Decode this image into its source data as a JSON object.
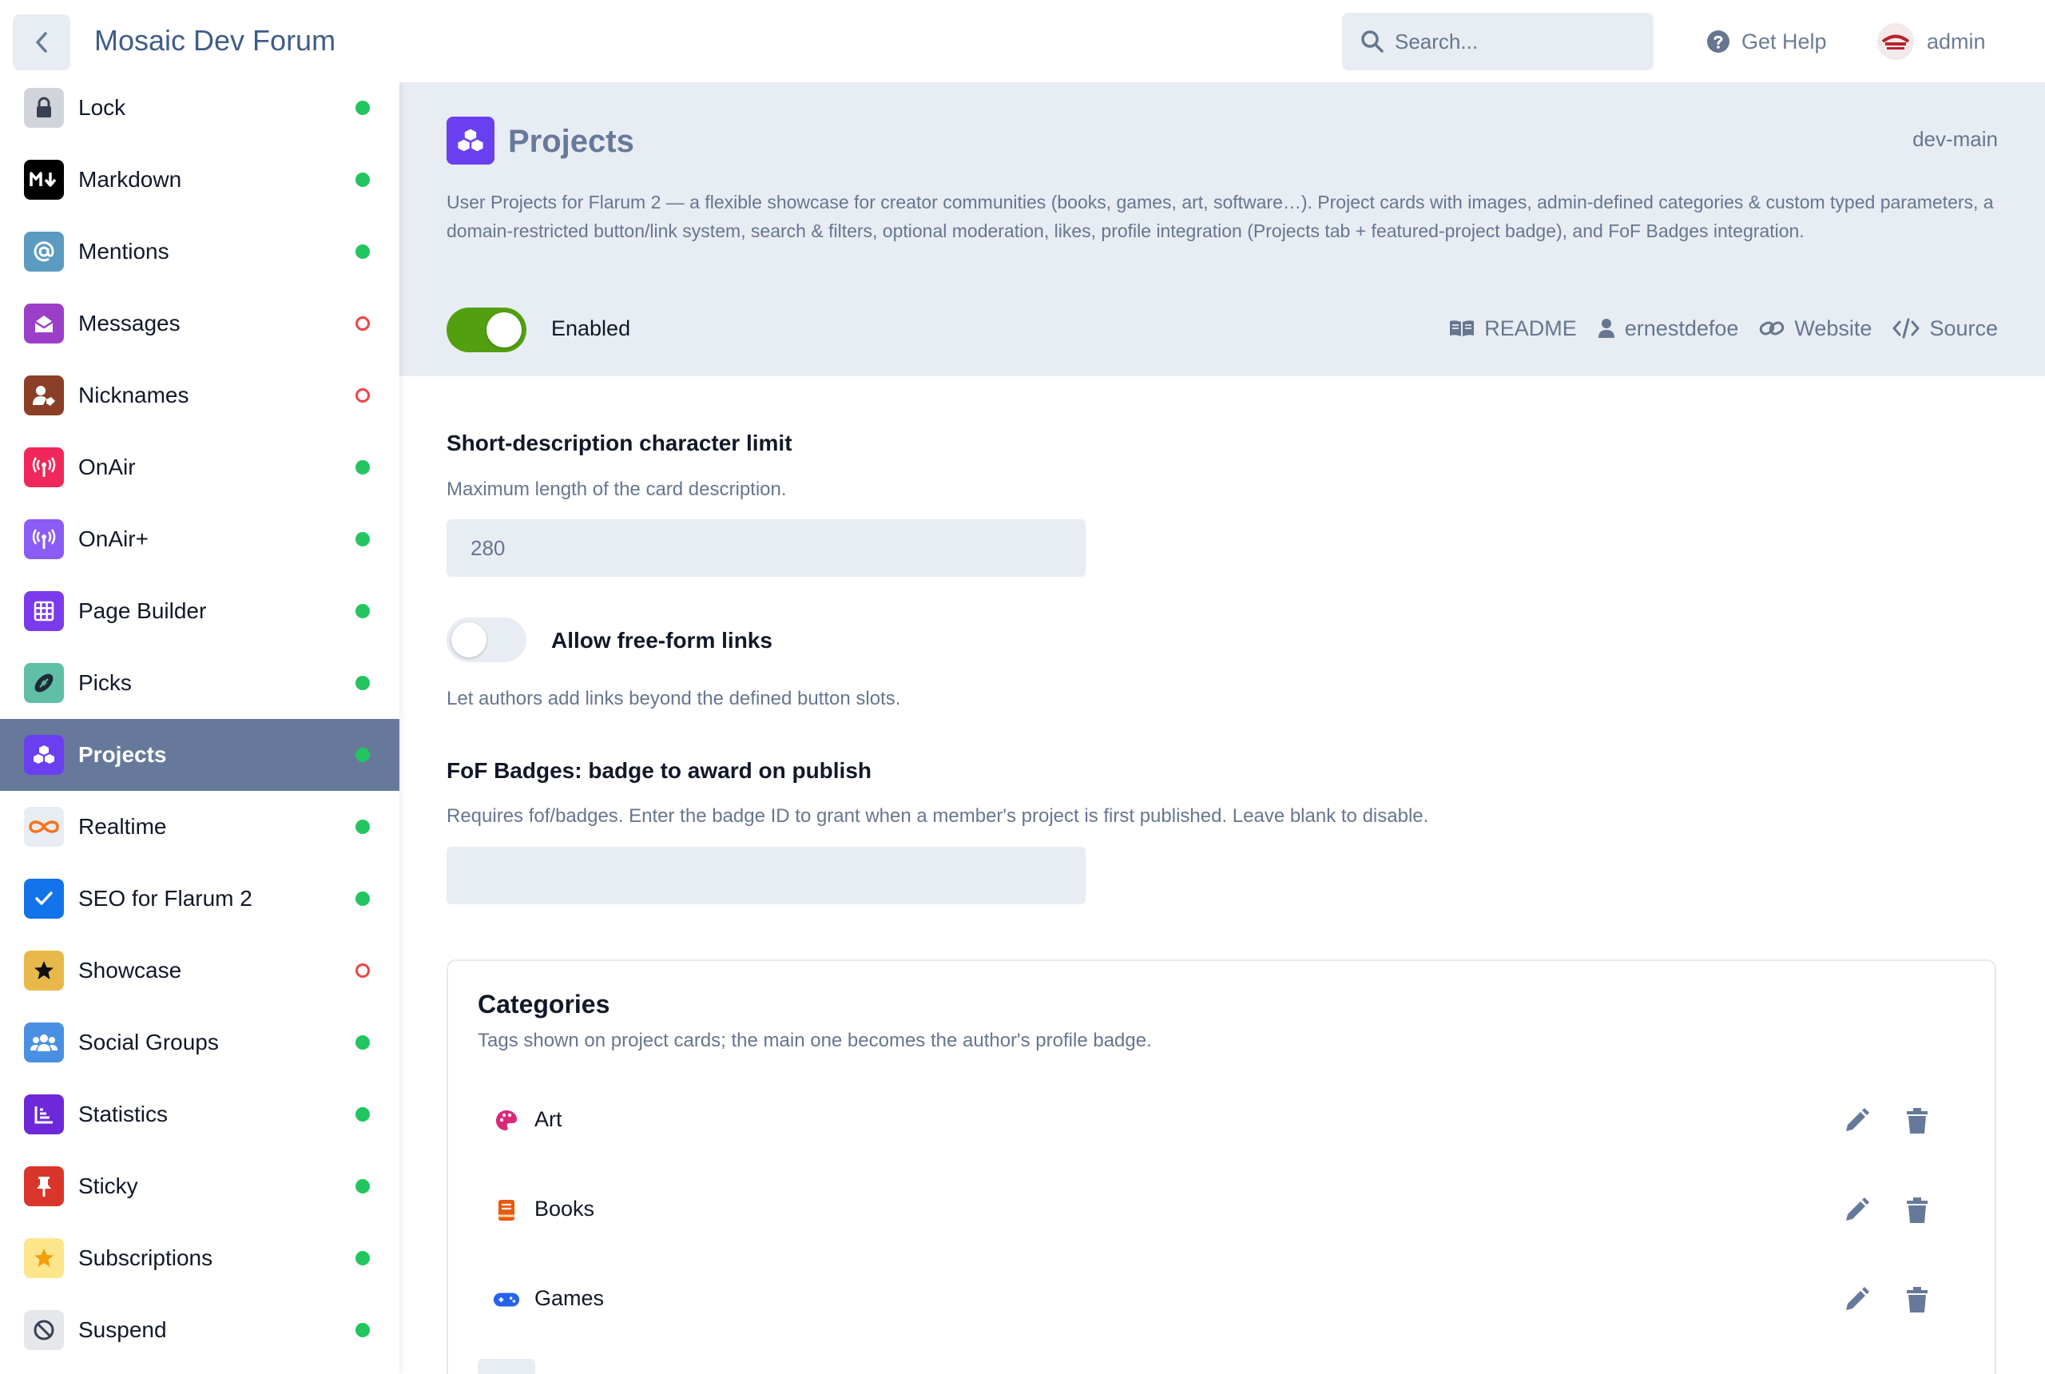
{
  "header": {
    "forum_title": "Mosaic Dev Forum",
    "search_placeholder": "Search...",
    "help_label": "Get Help",
    "user_name": "admin"
  },
  "sidebar": {
    "items": [
      {
        "label": "Lock",
        "status": "enabled",
        "icon": "lock-icon",
        "color": "#d1d5db"
      },
      {
        "label": "Markdown",
        "status": "enabled",
        "icon": "markdown-icon",
        "color": "#000000"
      },
      {
        "label": "Mentions",
        "status": "enabled",
        "icon": "at-icon",
        "color": "#5b9bc0"
      },
      {
        "label": "Messages",
        "status": "disabled",
        "icon": "envelope-open-icon",
        "color": "#9b3fc9"
      },
      {
        "label": "Nicknames",
        "status": "disabled",
        "icon": "user-tag-icon",
        "color": "#8b3f26"
      },
      {
        "label": "OnAir",
        "status": "enabled",
        "icon": "broadcast-icon",
        "color": "#f0275a"
      },
      {
        "label": "OnAir+",
        "status": "enabled",
        "icon": "broadcast-icon",
        "color": "#8b5cf6"
      },
      {
        "label": "Page Builder",
        "status": "enabled",
        "icon": "grid-icon",
        "color": "#7c3aed"
      },
      {
        "label": "Picks",
        "status": "enabled",
        "icon": "football-icon",
        "color": "#5fbfa6"
      },
      {
        "label": "Projects",
        "status": "enabled",
        "icon": "cubes-icon",
        "color": "#6a3ff0",
        "active": true
      },
      {
        "label": "Realtime",
        "status": "enabled",
        "icon": "infinity-icon",
        "color": "#e8ecf3"
      },
      {
        "label": "SEO for Flarum 2",
        "status": "enabled",
        "icon": "check-icon",
        "color": "#1273eb"
      },
      {
        "label": "Showcase",
        "status": "disabled",
        "icon": "star-icon",
        "color": "#e8b94a"
      },
      {
        "label": "Social Groups",
        "status": "enabled",
        "icon": "users-icon",
        "color": "#4a90e2"
      },
      {
        "label": "Statistics",
        "status": "enabled",
        "icon": "chart-icon",
        "color": "#6d28d9"
      },
      {
        "label": "Sticky",
        "status": "enabled",
        "icon": "thumbtack-icon",
        "color": "#d9352b"
      },
      {
        "label": "Subscriptions",
        "status": "enabled",
        "icon": "star-icon",
        "color": "#fde68a"
      },
      {
        "label": "Suspend",
        "status": "enabled",
        "icon": "ban-icon",
        "color": "#e5e7eb"
      }
    ]
  },
  "extension": {
    "title": "Projects",
    "version": "dev-main",
    "description": "User Projects for Flarum 2 — a flexible showcase for creator communities (books, games, art, software…). Project cards with images, admin-defined categories & custom typed parameters, a domain-restricted button/link system, search & filters, optional moderation, likes, profile integration (Projects tab + featured-project badge), and FoF Badges integration.",
    "enabled_label": "Enabled",
    "enabled": true,
    "links": {
      "readme": "README",
      "author": "ernestdefoe",
      "website": "Website",
      "source": "Source"
    }
  },
  "settings": {
    "char_limit_label": "Short-description character limit",
    "char_limit_help": "Maximum length of the card description.",
    "char_limit_value": "280",
    "freeform_label": "Allow free-form links",
    "freeform_help": "Let authors add links beyond the defined button slots.",
    "freeform_enabled": false,
    "badge_label": "FoF Badges: badge to award on publish",
    "badge_help": "Requires fof/badges. Enter the badge ID to grant when a member's project is first published. Leave blank to disable.",
    "badge_value": ""
  },
  "categories": {
    "title": "Categories",
    "subtitle": "Tags shown on project cards; the main one becomes the author's profile badge.",
    "items": [
      {
        "label": "Art",
        "icon": "palette-icon",
        "color": "#db2777"
      },
      {
        "label": "Books",
        "icon": "book-icon",
        "color": "#ea580c"
      },
      {
        "label": "Games",
        "icon": "gamepad-icon",
        "color": "#2563eb"
      }
    ]
  },
  "colors": {
    "accent": "#66799a",
    "toggle_on": "#52a010",
    "status_on": "#22c55e",
    "status_off": "#ef4444"
  }
}
